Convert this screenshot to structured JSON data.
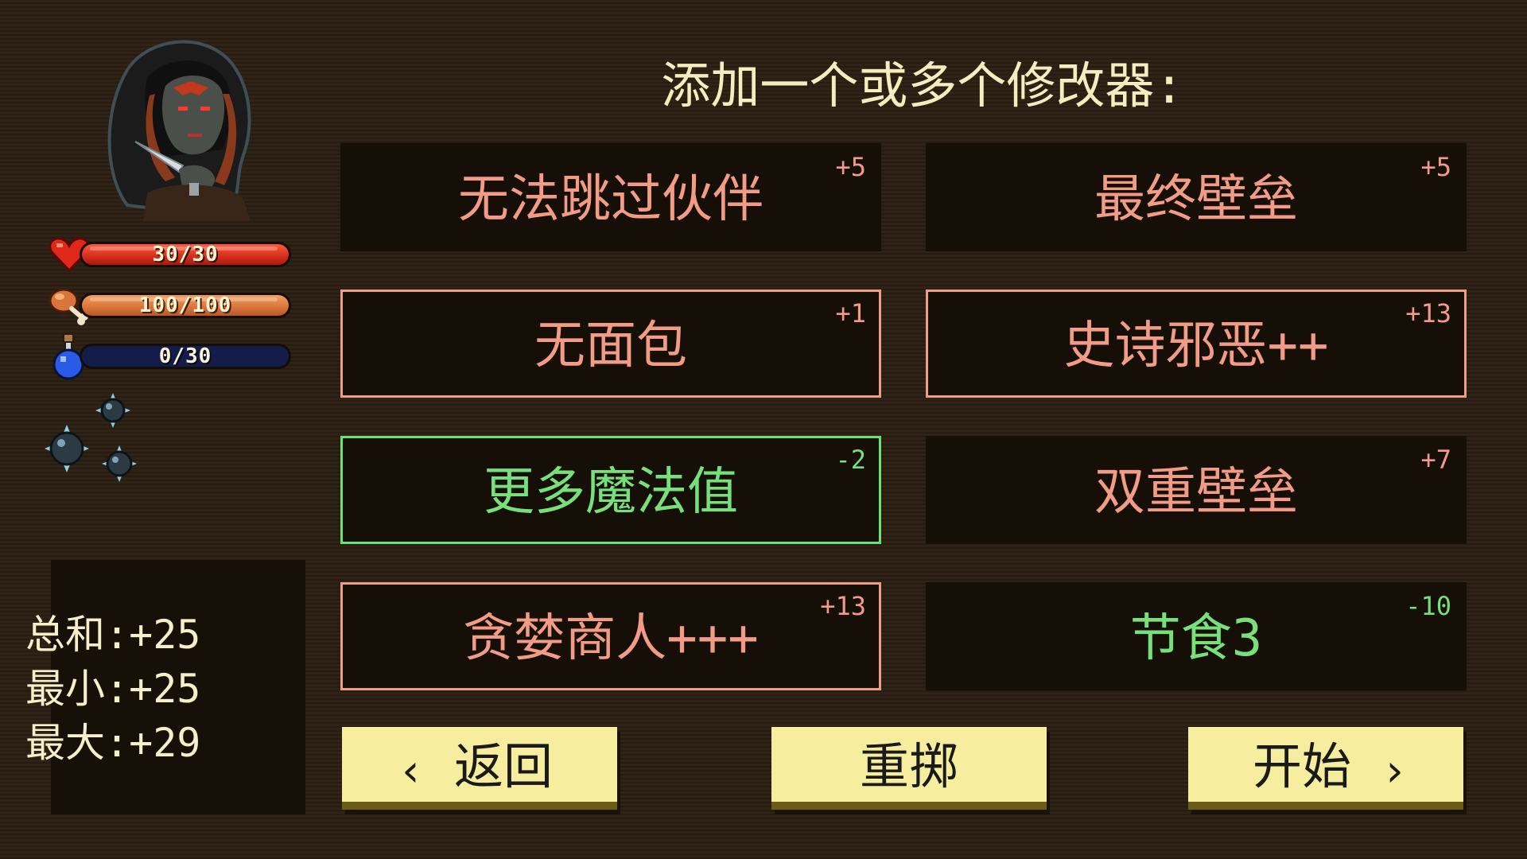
{
  "header": {
    "title": "添加一个或多个修改器:"
  },
  "character": {
    "portrait_icon": "hooded-character-portrait",
    "hp": {
      "text": "30/30",
      "fill": 1.0,
      "icon": "heart-icon"
    },
    "food": {
      "text": "100/100",
      "fill": 1.0,
      "icon": "drumstick-icon"
    },
    "mana": {
      "text": "0/30",
      "fill": 0.0,
      "icon": "potion-icon"
    },
    "orbs_icon": "spiked-orbs-icon"
  },
  "totals": {
    "sum": "总和:+25",
    "min": "最小:+25",
    "max": "最大:+29"
  },
  "modifiers": [
    {
      "name": "无法跳过伙伴",
      "value": "+5",
      "selected": false,
      "tone": "red"
    },
    {
      "name": "最终壁垒",
      "value": "+5",
      "selected": false,
      "tone": "red"
    },
    {
      "name": "无面包",
      "value": "+1",
      "selected": true,
      "tone": "red"
    },
    {
      "name": "史诗邪恶++",
      "value": "+13",
      "selected": true,
      "tone": "red"
    },
    {
      "name": "更多魔法值",
      "value": "-2",
      "selected": true,
      "tone": "green"
    },
    {
      "name": "双重壁垒",
      "value": "+7",
      "selected": false,
      "tone": "red"
    },
    {
      "name": "贪婪商人+++",
      "value": "+13",
      "selected": true,
      "tone": "red"
    },
    {
      "name": "节食3",
      "value": "-10",
      "selected": false,
      "tone": "green"
    }
  ],
  "buttons": {
    "back": {
      "label": "返回",
      "chevron": "‹"
    },
    "reroll": {
      "label": "重掷"
    },
    "start": {
      "label": "开始",
      "chevron": "›"
    }
  },
  "colors": {
    "background": "#2c1e12",
    "card_bg": "#160f08",
    "positive_text": "#f29b85",
    "negative_text": "#78e078",
    "button_bg": "#f6ee9e"
  }
}
